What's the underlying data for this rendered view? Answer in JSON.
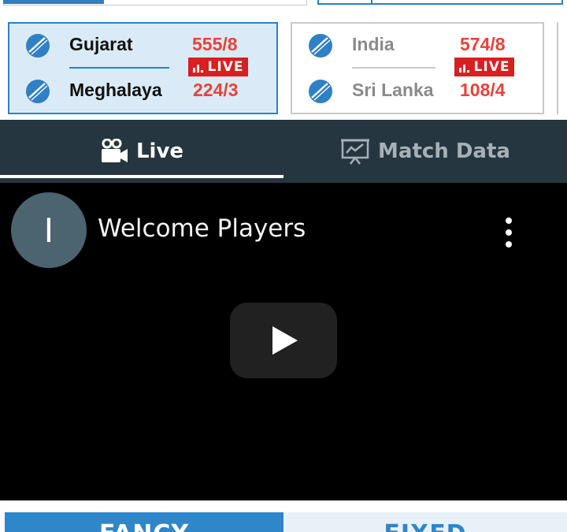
{
  "matches": [
    {
      "active": true,
      "teams": [
        {
          "name": "Gujarat",
          "score": "555/8"
        },
        {
          "name": "Meghalaya",
          "score": "224/3"
        }
      ],
      "live_label": "LIVE"
    },
    {
      "active": false,
      "teams": [
        {
          "name": "India",
          "score": "574/8"
        },
        {
          "name": "Sri Lanka",
          "score": "108/4"
        }
      ],
      "live_label": "LIVE"
    }
  ],
  "tabs": {
    "live": {
      "label": "Live",
      "icon": "video-camera-icon",
      "active": true
    },
    "match_data": {
      "label": "Match Data",
      "icon": "chart-board-icon",
      "active": false
    }
  },
  "video": {
    "channel_initial": "I",
    "title": "Welcome Players",
    "menu_icon": "more-vertical-icon",
    "play_icon": "play-icon"
  },
  "bottom_tabs": [
    {
      "label": "FANCY",
      "active": true
    },
    {
      "label": "FIXED",
      "active": false
    }
  ],
  "colors": {
    "accent_blue": "#2f80c4",
    "score_red": "#e8423a",
    "live_red": "#d91f1f",
    "tabbar_bg": "#263640",
    "active_card_bg": "#daebf7"
  }
}
